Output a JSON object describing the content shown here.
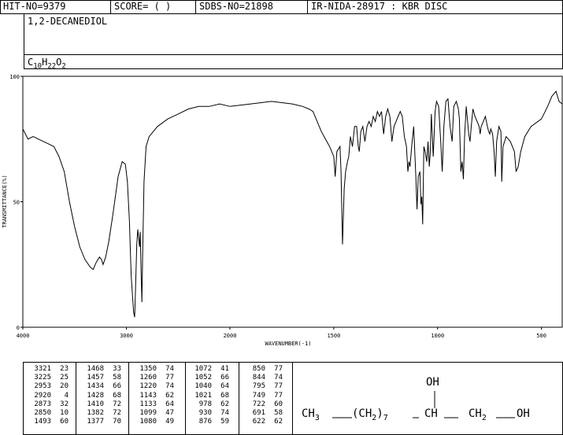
{
  "header": {
    "hit_no": "HIT-NO=9379",
    "score": "SCORE=  (   )",
    "sdbs_no": "SDBS-NO=21898",
    "ir_info": "IR-NIDA-28917 : KBR DISC"
  },
  "compound": {
    "name": "1,2-DECANEDIOL",
    "formula_parts": [
      "C",
      "10",
      "H",
      "22",
      "O",
      "2"
    ]
  },
  "chart_data": {
    "type": "line",
    "xlabel": "WAVENUMBER(-1)",
    "ylabel": "TRANSMITTANCE(%)",
    "xlim": [
      4000,
      400
    ],
    "ylim": [
      0,
      100
    ],
    "x_ticks": [
      4000,
      3000,
      2000,
      1500,
      1000,
      500
    ],
    "y_ticks": [
      0,
      50,
      100
    ],
    "x_tick_labels": [
      "4000",
      "3000",
      "2000",
      "1500",
      "1000",
      "500"
    ],
    "y_tick_labels": [
      "0",
      "50",
      "100"
    ],
    "series": [
      {
        "values": [
          [
            4000,
            79
          ],
          [
            3950,
            75
          ],
          [
            3900,
            76
          ],
          [
            3850,
            75
          ],
          [
            3800,
            74
          ],
          [
            3750,
            73
          ],
          [
            3700,
            72
          ],
          [
            3650,
            68
          ],
          [
            3600,
            62
          ],
          [
            3550,
            50
          ],
          [
            3500,
            40
          ],
          [
            3450,
            32
          ],
          [
            3400,
            27
          ],
          [
            3350,
            24
          ],
          [
            3321,
            23
          ],
          [
            3290,
            26
          ],
          [
            3260,
            28
          ],
          [
            3240,
            27
          ],
          [
            3225,
            25
          ],
          [
            3200,
            28
          ],
          [
            3170,
            34
          ],
          [
            3130,
            45
          ],
          [
            3080,
            60
          ],
          [
            3040,
            66
          ],
          [
            3010,
            65
          ],
          [
            2990,
            58
          ],
          [
            2970,
            42
          ],
          [
            2960,
            28
          ],
          [
            2953,
            20
          ],
          [
            2940,
            12
          ],
          [
            2930,
            6
          ],
          [
            2920,
            4
          ],
          [
            2912,
            15
          ],
          [
            2900,
            33
          ],
          [
            2890,
            39
          ],
          [
            2882,
            36
          ],
          [
            2873,
            32
          ],
          [
            2866,
            38
          ],
          [
            2858,
            22
          ],
          [
            2850,
            10
          ],
          [
            2843,
            28
          ],
          [
            2830,
            58
          ],
          [
            2810,
            72
          ],
          [
            2780,
            76
          ],
          [
            2700,
            80
          ],
          [
            2600,
            83
          ],
          [
            2500,
            85
          ],
          [
            2400,
            87
          ],
          [
            2300,
            88
          ],
          [
            2200,
            88
          ],
          [
            2100,
            89
          ],
          [
            2000,
            88
          ],
          [
            1900,
            89
          ],
          [
            1800,
            90
          ],
          [
            1700,
            89
          ],
          [
            1650,
            88
          ],
          [
            1620,
            87
          ],
          [
            1600,
            86
          ],
          [
            1580,
            82
          ],
          [
            1560,
            78
          ],
          [
            1540,
            75
          ],
          [
            1520,
            72
          ],
          [
            1500,
            68
          ],
          [
            1493,
            60
          ],
          [
            1485,
            70
          ],
          [
            1470,
            72
          ],
          [
            1465,
            62
          ],
          [
            1458,
            33
          ],
          [
            1450,
            55
          ],
          [
            1443,
            62
          ],
          [
            1434,
            66
          ],
          [
            1428,
            68
          ],
          [
            1420,
            76
          ],
          [
            1410,
            72
          ],
          [
            1400,
            80
          ],
          [
            1390,
            80
          ],
          [
            1382,
            72
          ],
          [
            1377,
            70
          ],
          [
            1370,
            78
          ],
          [
            1360,
            80
          ],
          [
            1350,
            74
          ],
          [
            1340,
            80
          ],
          [
            1330,
            82
          ],
          [
            1320,
            80
          ],
          [
            1310,
            84
          ],
          [
            1300,
            82
          ],
          [
            1290,
            86
          ],
          [
            1280,
            84
          ],
          [
            1270,
            86
          ],
          [
            1260,
            77
          ],
          [
            1250,
            84
          ],
          [
            1240,
            87
          ],
          [
            1230,
            84
          ],
          [
            1220,
            74
          ],
          [
            1210,
            80
          ],
          [
            1200,
            82
          ],
          [
            1190,
            84
          ],
          [
            1180,
            86
          ],
          [
            1170,
            84
          ],
          [
            1160,
            76
          ],
          [
            1150,
            72
          ],
          [
            1143,
            62
          ],
          [
            1138,
            66
          ],
          [
            1133,
            64
          ],
          [
            1125,
            72
          ],
          [
            1115,
            80
          ],
          [
            1105,
            60
          ],
          [
            1099,
            47
          ],
          [
            1093,
            60
          ],
          [
            1085,
            62
          ],
          [
            1080,
            49
          ],
          [
            1076,
            52
          ],
          [
            1072,
            41
          ],
          [
            1066,
            72
          ],
          [
            1060,
            70
          ],
          [
            1052,
            66
          ],
          [
            1046,
            74
          ],
          [
            1040,
            64
          ],
          [
            1035,
            70
          ],
          [
            1030,
            85
          ],
          [
            1021,
            68
          ],
          [
            1012,
            86
          ],
          [
            1005,
            90
          ],
          [
            995,
            88
          ],
          [
            985,
            74
          ],
          [
            978,
            62
          ],
          [
            970,
            80
          ],
          [
            960,
            90
          ],
          [
            950,
            91
          ],
          [
            940,
            80
          ],
          [
            930,
            74
          ],
          [
            922,
            88
          ],
          [
            910,
            90
          ],
          [
            900,
            87
          ],
          [
            895,
            83
          ],
          [
            888,
            62
          ],
          [
            882,
            66
          ],
          [
            876,
            59
          ],
          [
            870,
            76
          ],
          [
            862,
            88
          ],
          [
            850,
            77
          ],
          [
            844,
            74
          ],
          [
            838,
            80
          ],
          [
            830,
            87
          ],
          [
            820,
            84
          ],
          [
            810,
            82
          ],
          [
            800,
            80
          ],
          [
            795,
            77
          ],
          [
            790,
            80
          ],
          [
            780,
            82
          ],
          [
            770,
            84
          ],
          [
            760,
            80
          ],
          [
            754,
            78
          ],
          [
            749,
            77
          ],
          [
            744,
            79
          ],
          [
            735,
            77
          ],
          [
            728,
            70
          ],
          [
            722,
            60
          ],
          [
            716,
            74
          ],
          [
            705,
            80
          ],
          [
            695,
            78
          ],
          [
            691,
            58
          ],
          [
            685,
            72
          ],
          [
            670,
            76
          ],
          [
            650,
            74
          ],
          [
            630,
            70
          ],
          [
            622,
            62
          ],
          [
            612,
            64
          ],
          [
            600,
            70
          ],
          [
            580,
            76
          ],
          [
            550,
            80
          ],
          [
            500,
            83
          ],
          [
            470,
            88
          ],
          [
            450,
            92
          ],
          [
            430,
            94
          ],
          [
            415,
            90
          ],
          [
            400,
            89
          ]
        ]
      }
    ]
  },
  "peak_table": [
    [
      [
        "3321",
        "23"
      ],
      [
        "3225",
        "25"
      ],
      [
        "2953",
        "20"
      ],
      [
        "2920",
        "4"
      ],
      [
        "2873",
        "32"
      ],
      [
        "2850",
        "10"
      ],
      [
        "1493",
        "60"
      ]
    ],
    [
      [
        "1468",
        "33"
      ],
      [
        "1457",
        "58"
      ],
      [
        "1434",
        "66"
      ],
      [
        "1428",
        "68"
      ],
      [
        "1410",
        "72"
      ],
      [
        "1382",
        "72"
      ],
      [
        "1377",
        "70"
      ]
    ],
    [
      [
        "1350",
        "74"
      ],
      [
        "1260",
        "77"
      ],
      [
        "1220",
        "74"
      ],
      [
        "1143",
        "62"
      ],
      [
        "1133",
        "64"
      ],
      [
        "1099",
        "47"
      ],
      [
        "1080",
        "49"
      ]
    ],
    [
      [
        "1072",
        "41"
      ],
      [
        "1052",
        "66"
      ],
      [
        "1040",
        "64"
      ],
      [
        "1021",
        "68"
      ],
      [
        "978",
        "62"
      ],
      [
        "930",
        "74"
      ],
      [
        "876",
        "59"
      ]
    ],
    [
      [
        "850",
        "77"
      ],
      [
        "844",
        "74"
      ],
      [
        "795",
        "77"
      ],
      [
        "749",
        "77"
      ],
      [
        "722",
        "60"
      ],
      [
        "691",
        "58"
      ],
      [
        "622",
        "62"
      ]
    ]
  ],
  "structure": {
    "oh_top": "OH",
    "ch3": "CH",
    "ch3_sub": "3",
    "ch2_group": "(CH",
    "ch2_sub": "2",
    "repeat_sub": "7",
    "ch": "CH",
    "ch2b": "CH",
    "ch2b_sub": "2",
    "oh_end": "OH"
  }
}
